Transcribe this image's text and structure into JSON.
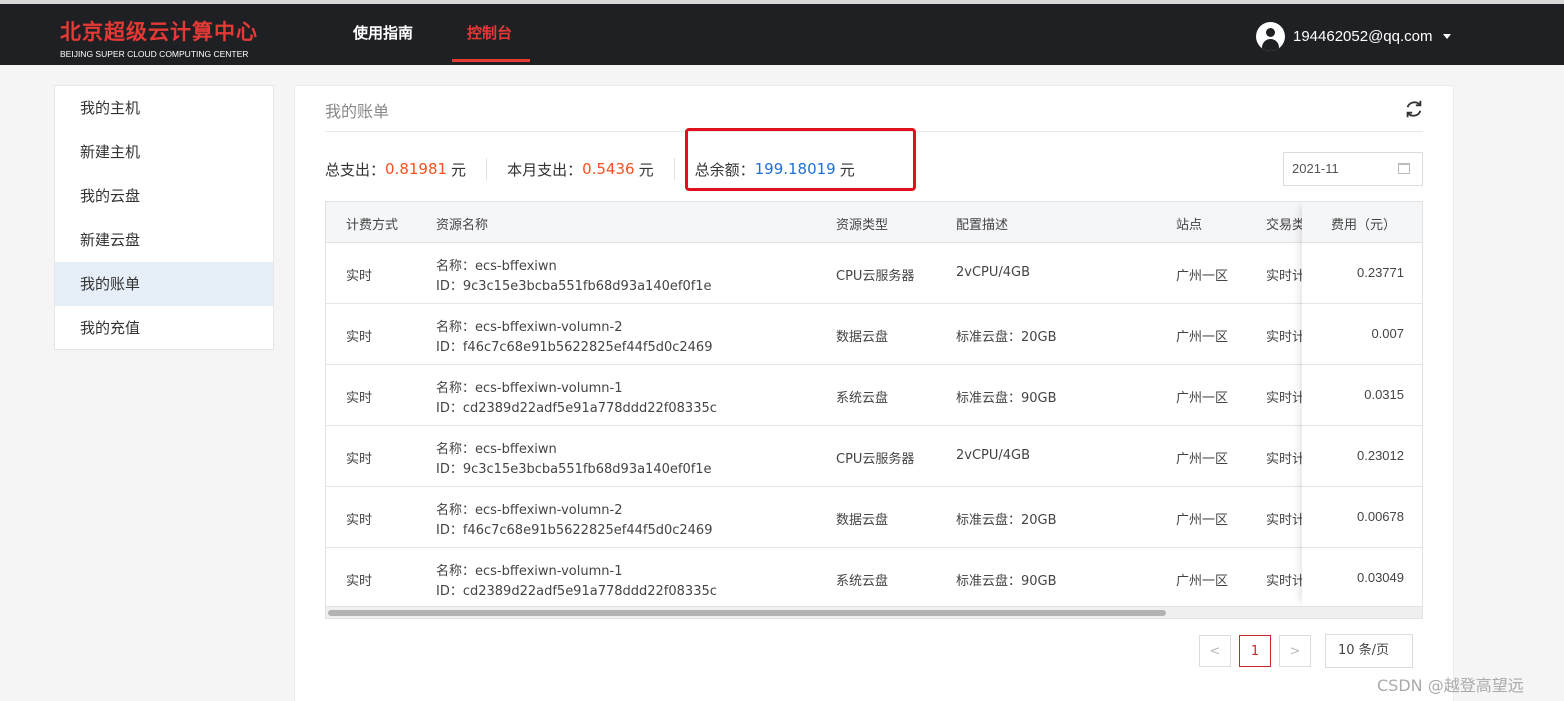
{
  "header": {
    "logo_cn": "北京超级云计算中心",
    "logo_en": "BEIJING SUPER CLOUD COMPUTING CENTER",
    "nav": [
      "使用指南",
      "控制台"
    ],
    "active_nav": "控制台",
    "user_email": "194462052@qq.com"
  },
  "sidebar": {
    "items": [
      {
        "label": "我的主机"
      },
      {
        "label": "新建主机"
      },
      {
        "label": "我的云盘"
      },
      {
        "label": "新建云盘"
      },
      {
        "label": "我的账单",
        "active": true
      },
      {
        "label": "我的充值"
      }
    ]
  },
  "bill": {
    "title": "我的账单",
    "total_spend_label": "总支出：",
    "total_spend": "0.81981",
    "month_spend_label": "本月支出：",
    "month_spend": "0.5436",
    "balance_label": "总余额：",
    "balance": "199.18019",
    "unit": "元",
    "month": "2021-11"
  },
  "table": {
    "columns": [
      "计费方式",
      "资源名称",
      "资源类型",
      "配置描述",
      "站点",
      "交易类",
      "费用（元）"
    ],
    "rows": [
      {
        "billing": "实时",
        "name": "名称：ecs-bffexiwn",
        "id": "ID：9c3c15e3bcba551fb68d93a140ef0f1e",
        "type": "CPU云服务器",
        "config": "2vCPU/4GB",
        "site": "广州一区",
        "trade": "实时计",
        "fee": "0.23771"
      },
      {
        "billing": "实时",
        "name": "名称：ecs-bffexiwn-volumn-2",
        "id": "ID：f46c7c68e91b5622825ef44f5d0c2469",
        "type": "数据云盘",
        "config": "标准云盘：20GB",
        "site": "广州一区",
        "trade": "实时计",
        "fee": "0.007"
      },
      {
        "billing": "实时",
        "name": "名称：ecs-bffexiwn-volumn-1",
        "id": "ID：cd2389d22adf5e91a778ddd22f08335c",
        "type": "系统云盘",
        "config": "标准云盘：90GB",
        "site": "广州一区",
        "trade": "实时计",
        "fee": "0.0315"
      },
      {
        "billing": "实时",
        "name": "名称：ecs-bffexiwn",
        "id": "ID：9c3c15e3bcba551fb68d93a140ef0f1e",
        "type": "CPU云服务器",
        "config": "2vCPU/4GB",
        "site": "广州一区",
        "trade": "实时计",
        "fee": "0.23012"
      },
      {
        "billing": "实时",
        "name": "名称：ecs-bffexiwn-volumn-2",
        "id": "ID：f46c7c68e91b5622825ef44f5d0c2469",
        "type": "数据云盘",
        "config": "标准云盘：20GB",
        "site": "广州一区",
        "trade": "实时计",
        "fee": "0.00678"
      },
      {
        "billing": "实时",
        "name": "名称：ecs-bffexiwn-volumn-1",
        "id": "ID：cd2389d22adf5e91a778ddd22f08335c",
        "type": "系统云盘",
        "config": "标准云盘：90GB",
        "site": "广州一区",
        "trade": "实时计",
        "fee": "0.03049"
      }
    ]
  },
  "pagination": {
    "prev": "<",
    "current": "1",
    "next": ">",
    "page_size": "10 条/页"
  },
  "watermark": "CSDN @越登高望远"
}
